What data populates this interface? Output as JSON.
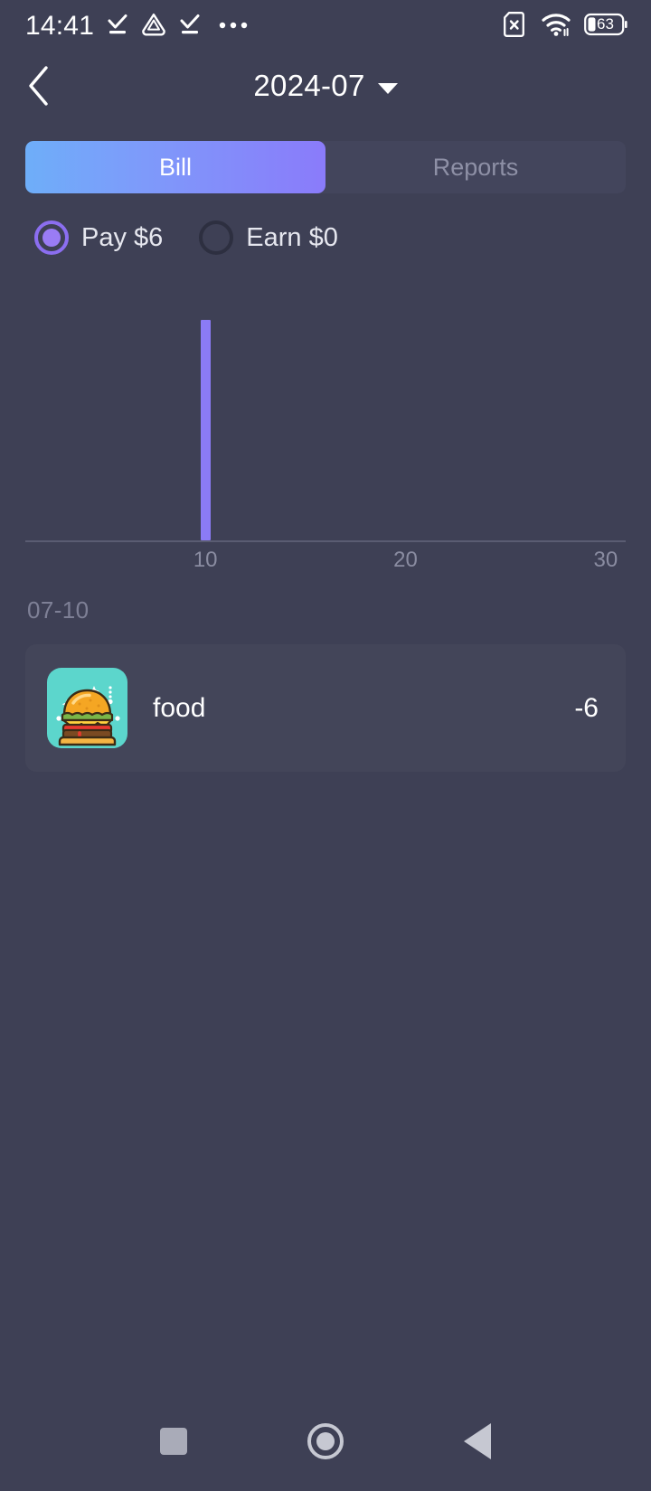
{
  "status_bar": {
    "clock": "14:41",
    "left_icons": [
      "download-done-icon",
      "triangle-app-icon",
      "download-done-icon",
      "more-dots-icon"
    ],
    "right_icons": [
      "sim-card-off-icon",
      "wifi-icon",
      "battery-icon"
    ],
    "battery_level": "63"
  },
  "header": {
    "back_label": "back-chevron",
    "title": "2024-07",
    "dropdown": "chevron-down"
  },
  "tabs": [
    {
      "label": "Bill",
      "active": true
    },
    {
      "label": "Reports",
      "active": false
    }
  ],
  "filters": [
    {
      "label": "Pay $6",
      "selected": true
    },
    {
      "label": "Earn $0",
      "selected": false
    }
  ],
  "chart_data": {
    "type": "bar",
    "title": "",
    "xlabel": "",
    "ylabel": "",
    "categories": [
      "10"
    ],
    "x": [
      10
    ],
    "values": [
      6
    ],
    "ylim": [
      0,
      6.6
    ],
    "xlim": [
      1,
      31
    ],
    "tick_labels": [
      "10",
      "20",
      "30"
    ],
    "tick_values": [
      10,
      20,
      30
    ],
    "grid": false,
    "legend": "none",
    "bar_color": "#8b7bf5",
    "axis_color": "#5a5c72"
  },
  "sections": [
    {
      "date": "07-10",
      "items": [
        {
          "icon": "food-burger-icon",
          "name": "food",
          "amount": "-6"
        }
      ]
    }
  ],
  "nav_bar": {
    "recents": "square-icon",
    "home": "circle-icon",
    "back": "triangle-back-icon"
  },
  "colors": {
    "background": "#3e4055",
    "card": "#434559",
    "accent_purple": "#8b7bf5",
    "gradient_start": "#6eaef9",
    "gradient_end": "#8a7bfa",
    "icon_teal": "#5cd6cc",
    "muted_text": "#8a8ca1"
  }
}
